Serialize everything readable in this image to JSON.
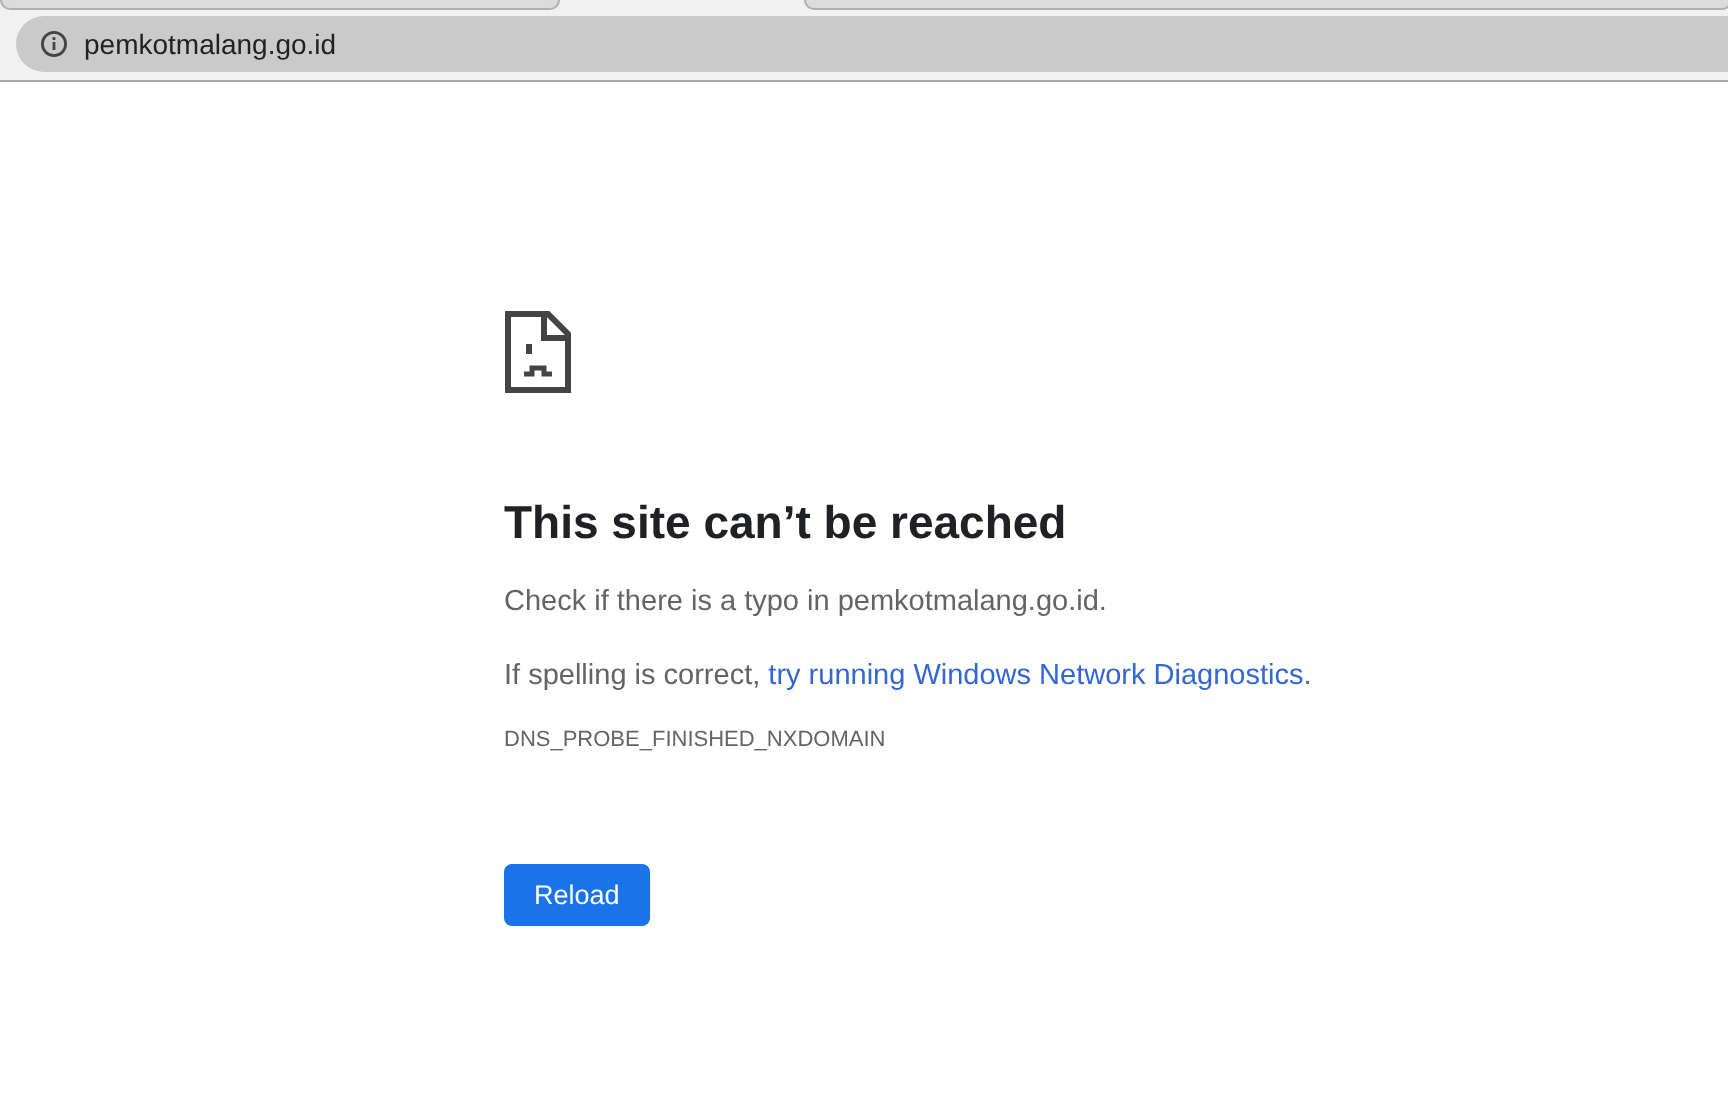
{
  "address_bar": {
    "url": "pemkotmalang.go.id"
  },
  "error": {
    "title": "This site can’t be reached",
    "message": "Check if there is a typo in pemkotmalang.go.id.",
    "suggestion": {
      "text": "If spelling is correct, ",
      "link": "try running Windows Network Diagnostics",
      "end": "."
    },
    "code": "DNS_PROBE_FINISHED_NXDOMAIN"
  },
  "buttons": [
    "Reload"
  ]
}
